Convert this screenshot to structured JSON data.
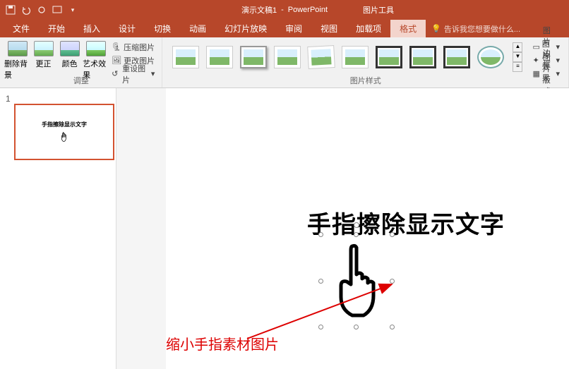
{
  "title": {
    "doc": "演示文稿1",
    "app": "PowerPoint",
    "contextual": "图片工具"
  },
  "tabs": {
    "file": "文件",
    "home": "开始",
    "insert": "插入",
    "design": "设计",
    "transitions": "切换",
    "animations": "动画",
    "slideshow": "幻灯片放映",
    "review": "审阅",
    "view": "视图",
    "addins": "加载项",
    "format": "格式",
    "tellme": "告诉我您想要做什么..."
  },
  "ribbon": {
    "adjust": {
      "label": "调整",
      "removeBg": "删除背景",
      "corrections": "更正",
      "color": "颜色",
      "artistic": "艺术效果",
      "compress": "压缩图片",
      "change": "更改图片",
      "reset": "重设图片"
    },
    "styles": {
      "label": "图片样式"
    },
    "format": {
      "border": "图片边框",
      "effects": "图片效果",
      "layout": "图片版式"
    }
  },
  "slide": {
    "num": "1",
    "thumbText": "手指擦除显示文字",
    "mainText": "手指擦除显示文字"
  },
  "annotation": "缩小手指素材图片"
}
